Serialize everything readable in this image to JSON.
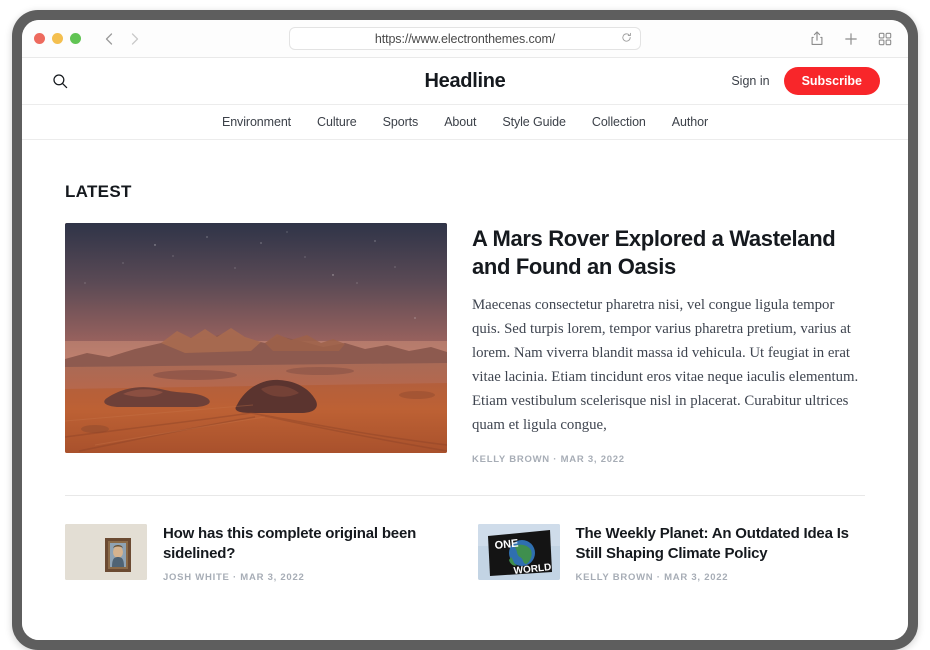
{
  "browser": {
    "url": "https://www.electronthemes.com/",
    "traffic_lights": [
      {
        "name": "close",
        "color": "#ed6a5e"
      },
      {
        "name": "minimize",
        "color": "#f4bf4f"
      },
      {
        "name": "maximize",
        "color": "#61c454"
      }
    ],
    "back_label": "‹",
    "forward_label": "›",
    "reload_label": "↻",
    "toolbar_icons": [
      "share-icon",
      "new-tab-icon",
      "tab-overview-icon"
    ]
  },
  "site": {
    "logo": "Headline",
    "search_icon": "search-icon",
    "sign_in_label": "Sign in",
    "subscribe_label": "Subscribe",
    "accent_color": "#f8262a",
    "nav": [
      {
        "label": "Environment"
      },
      {
        "label": "Culture"
      },
      {
        "label": "Sports"
      },
      {
        "label": "About"
      },
      {
        "label": "Style Guide"
      },
      {
        "label": "Collection"
      },
      {
        "label": "Author"
      }
    ]
  },
  "main": {
    "section_heading": "LATEST",
    "hero": {
      "title": "A Mars Rover Explored a Wasteland and Found an Oasis",
      "excerpt": "Maecenas consectetur pharetra nisi, vel congue ligula tempor quis. Sed turpis lorem, tempor varius pharetra pretium, varius at lorem. Nam viverra blandit massa id vehicula. Ut feugiat in erat vitae lacinia. Etiam tincidunt eros vitae neque iaculis elementum. Etiam vestibulum scelerisque nisl in placerat. Curabitur ultrices quam et ligula congue,",
      "author": "KELLY BROWN",
      "date": "MAR 3, 2022",
      "meta": "KELLY BROWN · MAR 3, 2022",
      "image_alt": "mars-desert-landscape-at-dusk"
    },
    "secondary": [
      {
        "title": "How has this complete original been sidelined?",
        "meta": "JOSH WHITE · MAR 3, 2022",
        "image_alt": "framed-portrait-painting-on-wall"
      },
      {
        "title": "The Weekly Planet: An Outdated Idea Is Still Shaping Climate Policy",
        "meta": "KELLY BROWN · MAR 3, 2022",
        "image_alt": "one-world-flag-with-globe"
      }
    ]
  }
}
